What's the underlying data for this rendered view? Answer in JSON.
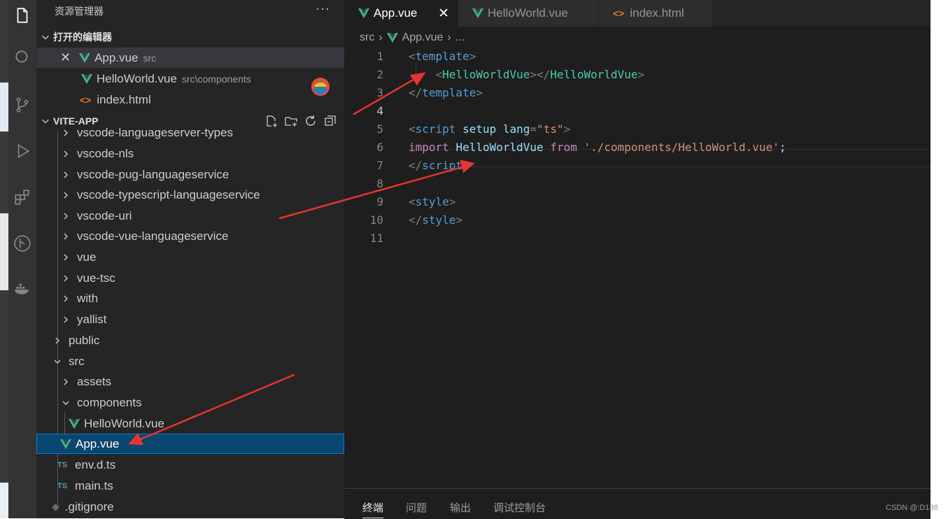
{
  "explorer": {
    "title": "资源管理器",
    "more": "···",
    "open_editors": {
      "header": "打开的编辑器",
      "items": [
        {
          "name": "App.vue",
          "desc": "src"
        },
        {
          "name": "HelloWorld.vue",
          "desc": "src\\components"
        },
        {
          "name": "index.html",
          "desc": ""
        }
      ]
    },
    "project": {
      "header": "VITE-APP",
      "items": [
        "vscode-languageserver-types",
        "vscode-nls",
        "vscode-pug-languageservice",
        "vscode-typescript-languageservice",
        "vscode-uri",
        "vscode-vue-languageservice",
        "vue",
        "vue-tsc",
        "with",
        "yallist",
        "public",
        "src",
        "assets",
        "components",
        "HelloWorld.vue",
        "App.vue",
        "env.d.ts",
        "main.ts",
        ".gitignore"
      ],
      "ts_badge": "TS"
    }
  },
  "tabs": [
    "App.vue",
    "HelloWorld.vue",
    "index.html"
  ],
  "breadcrumbs": [
    "src",
    "App.vue",
    "..."
  ],
  "code": {
    "line_numbers": [
      "1",
      "2",
      "3",
      "4",
      "5",
      "6",
      "7",
      "8",
      "9",
      "10",
      "11"
    ],
    "l1_tag": "template",
    "l2_comp_open": "HelloWorldVue",
    "l2_comp_close": "HelloWorldVue",
    "l3_tag": "template",
    "l5_tag": "script",
    "l5_attr1": "setup",
    "l5_attr2": "lang",
    "l5_val": "\"ts\"",
    "l6_kw": "import",
    "l6_id": "HelloWorldVue",
    "l6_from": "from",
    "l6_str": "'./components/HelloWorld.vue'",
    "l6_semi": ";",
    "l7_tag": "script",
    "l9_tag": "style",
    "l10_tag": "style"
  },
  "panel_tabs": [
    "终端",
    "问题",
    "输出",
    "调试控制台"
  ],
  "watermark": "CSDN @:D138",
  "colors": {
    "vue_green": "#41b883",
    "selected_row": "#094771",
    "arrow_red": "#e8332f"
  }
}
